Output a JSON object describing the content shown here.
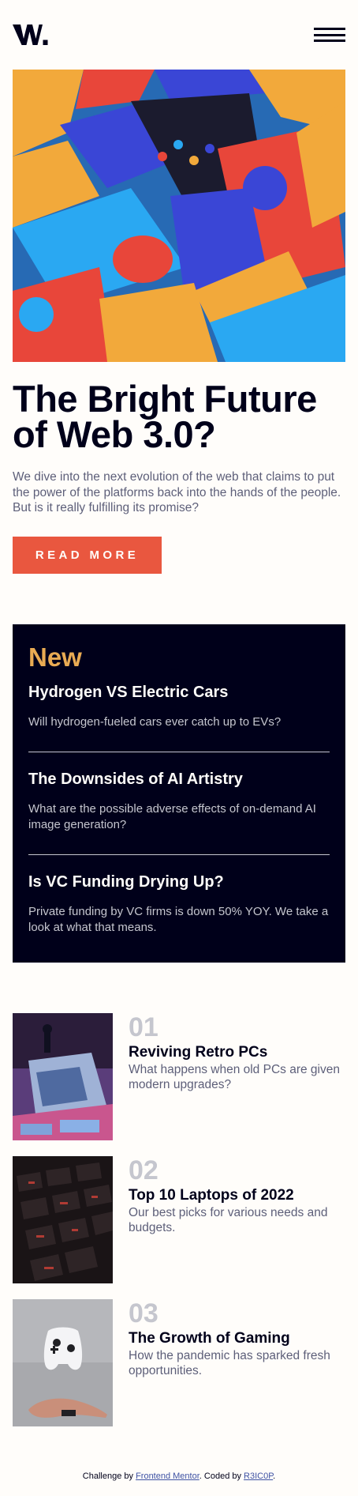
{
  "header": {
    "logo_text": "W.",
    "menu_icon": "hamburger-menu-icon"
  },
  "hero": {
    "title": "The Bright Future of Web 3.0?",
    "description": "We dive into the next evolution of the web that claims to put the power of the platforms back into the hands of the people. But is it really fulfilling its promise?",
    "button_label": "READ MORE"
  },
  "new_panel": {
    "heading": "New",
    "items": [
      {
        "title": "Hydrogen VS Electric Cars",
        "description": "Will hydrogen-fueled cars ever catch up to EVs?"
      },
      {
        "title": "The Downsides of AI Artistry",
        "description": "What are the possible adverse effects of on-demand AI image generation?"
      },
      {
        "title": "Is VC Funding Drying Up?",
        "description": "Private funding by VC firms is down 50% YOY. We take a look at what that means."
      }
    ]
  },
  "articles": [
    {
      "number": "01",
      "title": "Reviving Retro PCs",
      "description": "What happens when old PCs are given modern upgrades?"
    },
    {
      "number": "02",
      "title": "Top 10 Laptops of 2022",
      "description": "Our best picks for various needs and budgets."
    },
    {
      "number": "03",
      "title": "The Growth of Gaming",
      "description": "How the pandemic has sparked fresh opportunities."
    }
  ],
  "footer": {
    "prefix": "Challenge by",
    "challenge_link": "Frontend Mentor",
    "middle": ". Coded by",
    "author_link": "R3IC0P",
    "suffix": "."
  },
  "colors": {
    "accent_red": "#e9573f",
    "accent_orange": "#e9ab53",
    "dark_navy": "#00001a",
    "grayish_blue": "#5d5f79",
    "off_white": "#fffdfa"
  }
}
